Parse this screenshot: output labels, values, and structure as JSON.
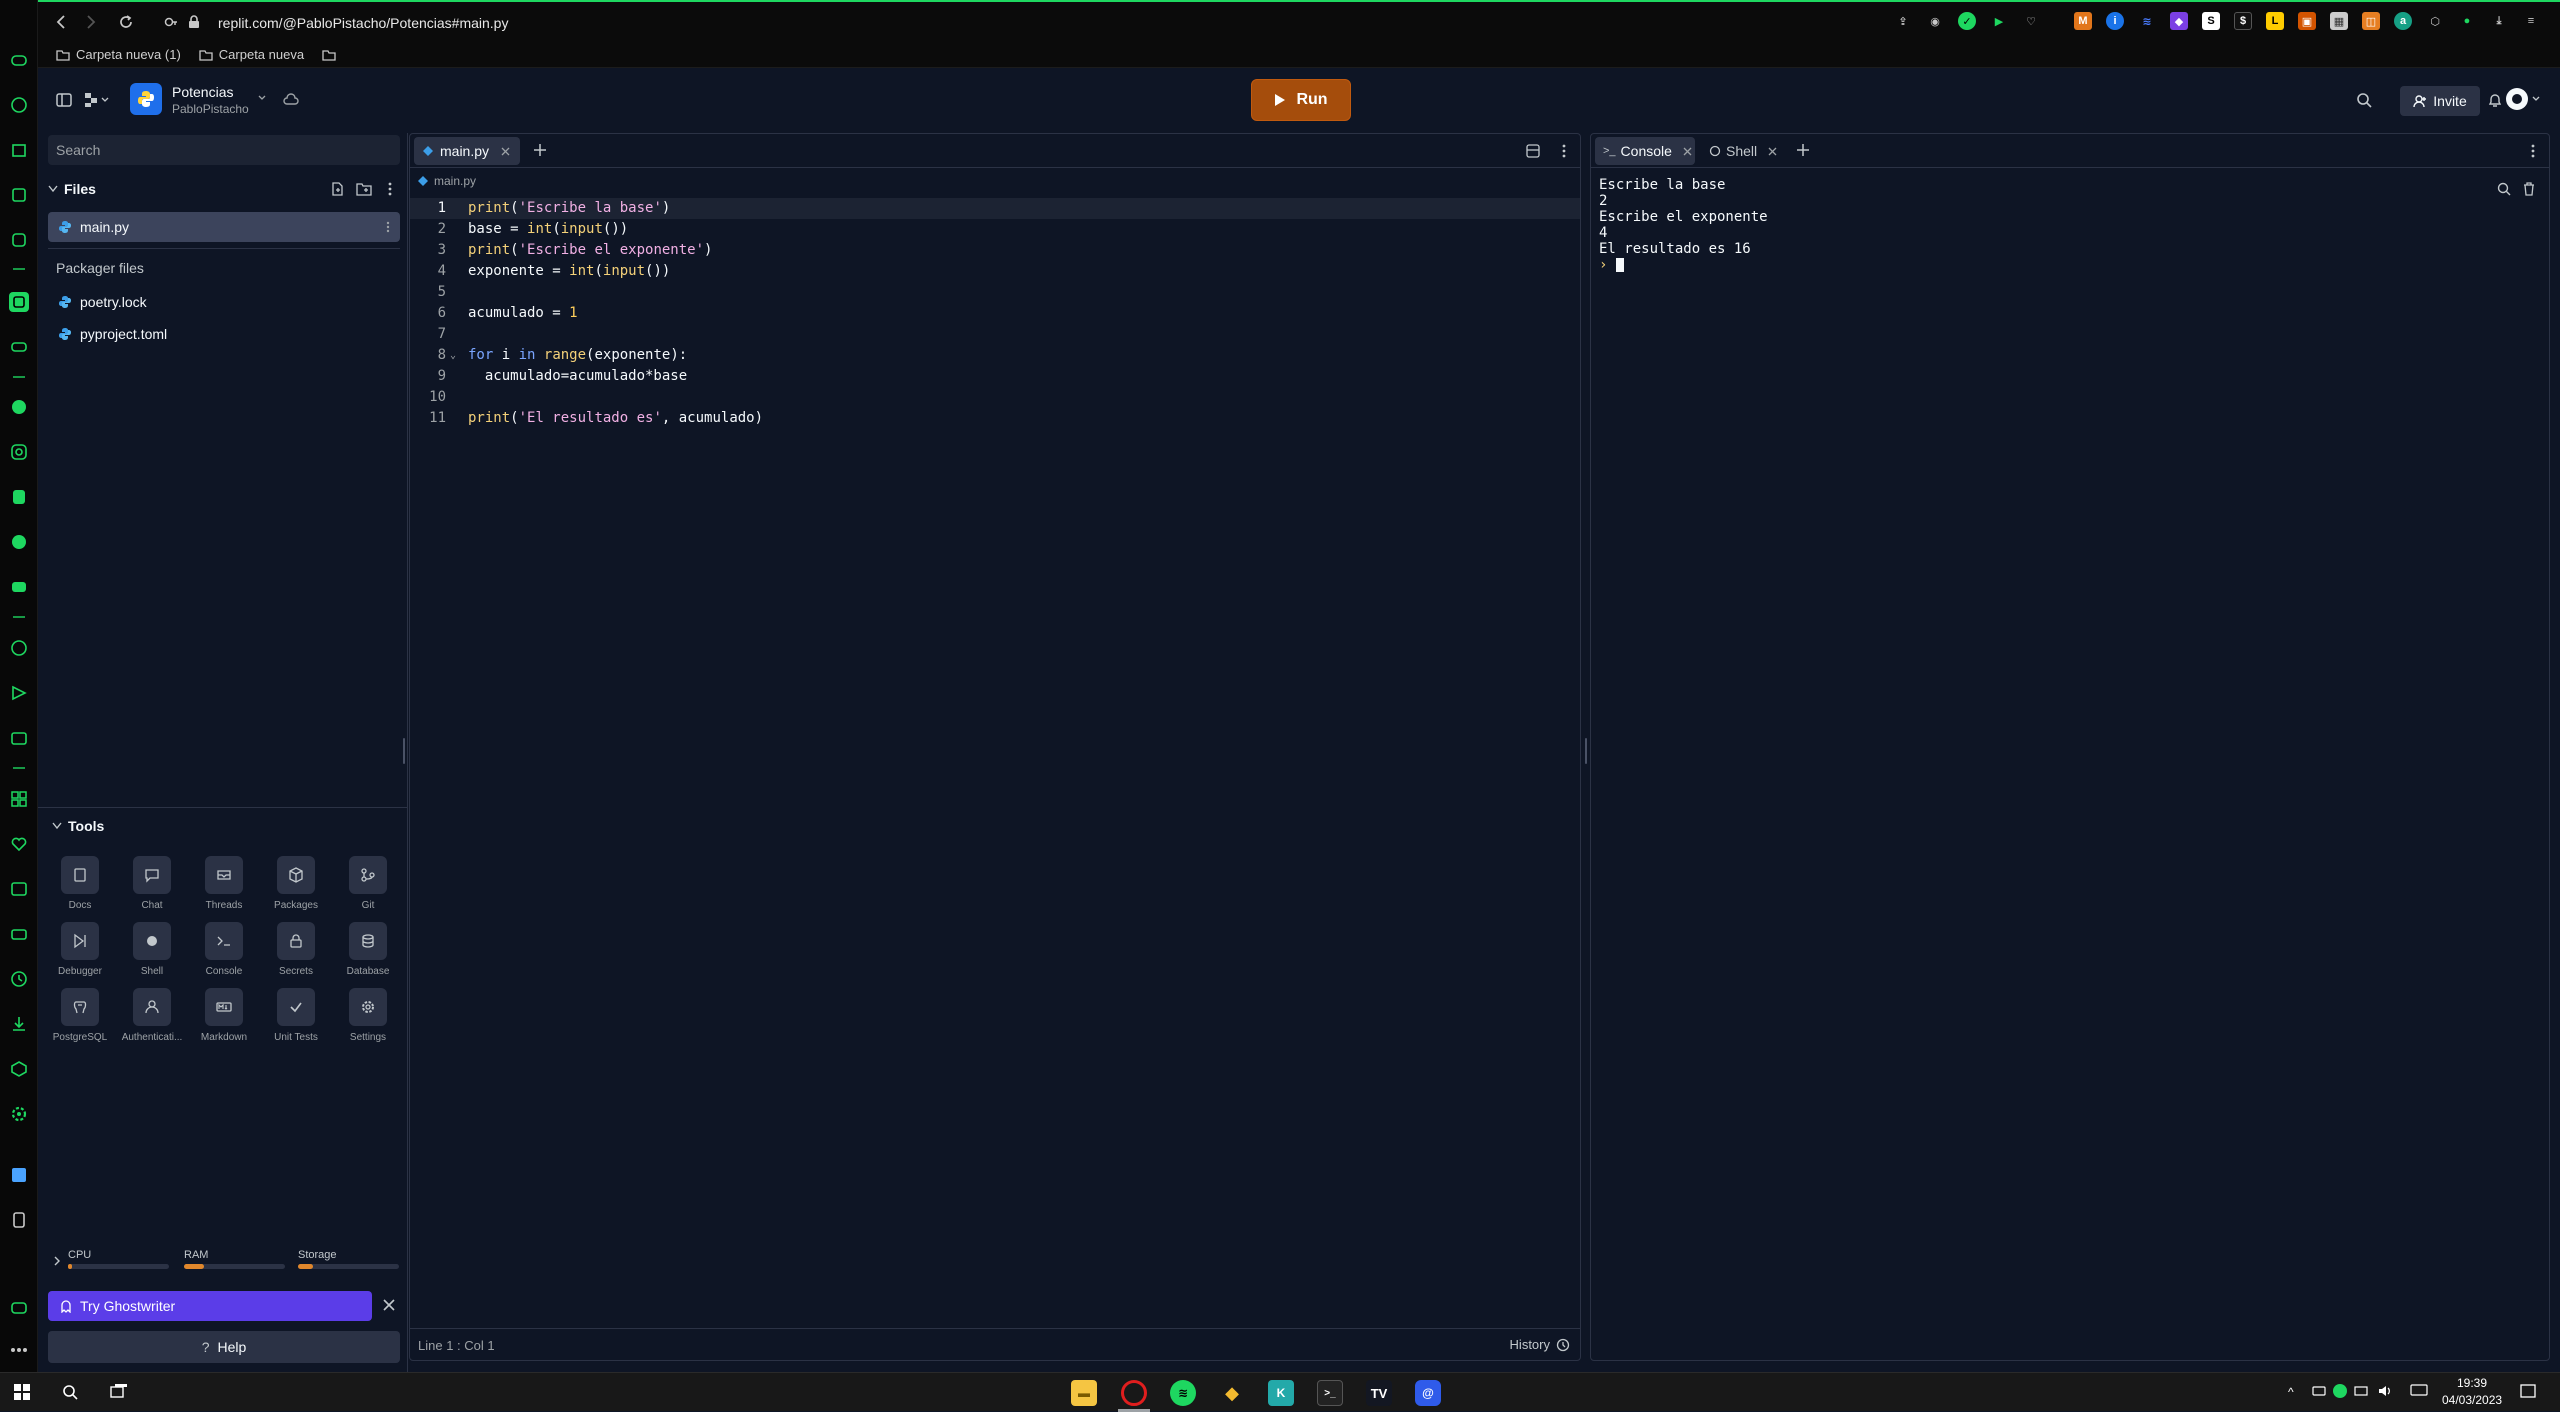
{
  "browser": {
    "url": "replit.com/@PabloPistacho/Potencias#main.py",
    "bookmarks": [
      "Carpeta nueva (1)",
      "Carpeta nueva"
    ]
  },
  "repl": {
    "name": "Potencias",
    "owner": "PabloPistacho",
    "run_label": "Run",
    "invite_label": "Invite"
  },
  "sidebar": {
    "search_placeholder": "Search",
    "files_header": "Files",
    "files": [
      "main.py"
    ],
    "packager_header": "Packager files",
    "packager_files": [
      "poetry.lock",
      "pyproject.toml"
    ],
    "tools_header": "Tools",
    "tools": [
      {
        "label": "Docs",
        "icon": "docs-icon"
      },
      {
        "label": "Chat",
        "icon": "chat-icon"
      },
      {
        "label": "Threads",
        "icon": "threads-icon"
      },
      {
        "label": "Packages",
        "icon": "packages-icon"
      },
      {
        "label": "Git",
        "icon": "git-icon"
      },
      {
        "label": "Debugger",
        "icon": "debugger-icon"
      },
      {
        "label": "Shell",
        "icon": "shell-icon"
      },
      {
        "label": "Console",
        "icon": "console-icon"
      },
      {
        "label": "Secrets",
        "icon": "lock-icon"
      },
      {
        "label": "Database",
        "icon": "database-icon"
      },
      {
        "label": "PostgreSQL",
        "icon": "postgres-icon"
      },
      {
        "label": "Authenticati...",
        "icon": "user-icon"
      },
      {
        "label": "Markdown",
        "icon": "markdown-icon"
      },
      {
        "label": "Unit Tests",
        "icon": "check-icon"
      },
      {
        "label": "Settings",
        "icon": "gear-icon"
      }
    ],
    "resources": {
      "cpu": "CPU",
      "ram": "RAM",
      "storage": "Storage",
      "cpu_level": 0.04,
      "ram_level": 0.2,
      "storage_level": 0.15
    },
    "ghostwriter": "Try Ghostwriter",
    "help": "Help"
  },
  "editor": {
    "tab": "main.py",
    "breadcrumb": "main.py",
    "lines": [
      "print('Escribe la base')",
      "base = int(input())",
      "print('Escribe el exponente')",
      "exponente = int(input())",
      "",
      "acumulado = 1",
      "",
      "for i in range(exponente):",
      "  acumulado=acumulado*base",
      "",
      "print('El resultado es', acumulado)"
    ],
    "status": "Line 1 : Col 1",
    "history": "History"
  },
  "console": {
    "tabs": [
      "Console",
      "Shell"
    ],
    "output": [
      "Escribe la base",
      "2",
      "Escribe el exponente",
      "4",
      "El resultado es 16"
    ]
  },
  "taskbar": {
    "time": "19:39",
    "date": "04/03/2023"
  },
  "colors": {
    "accent_green": "#1ed760",
    "run_orange": "#a54d0c",
    "ghostwriter_purple": "#5b3de8",
    "bg": "#0e1525"
  }
}
